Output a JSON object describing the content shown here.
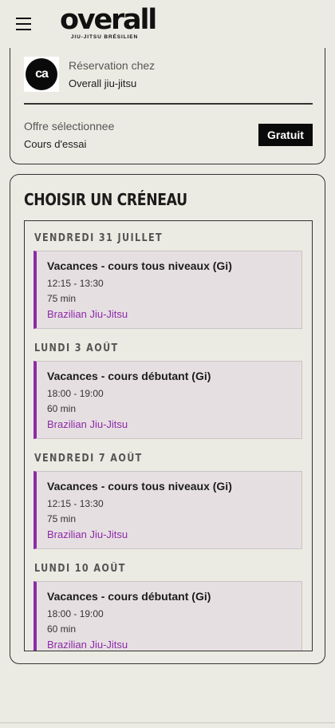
{
  "header": {
    "logo_text": "overall",
    "logo_tagline": "JIU-JITSU BRÉSILIEN"
  },
  "booking": {
    "gym_logo_text": "ca",
    "label": "Réservation chez",
    "gym_name": "Overall jiu-jitsu",
    "offer_label": "Offre sélectionnee",
    "offer_value": "Cours d'essai",
    "price_badge": "Gratuit"
  },
  "slots": {
    "title": "CHOISIR UN CRÉNEAU",
    "days": [
      {
        "date": "VENDREDI 31 JUILLET",
        "class": {
          "title": "Vacances - cours tous niveaux (Gi)",
          "time": "12:15 - 13:30",
          "duration": "75 min",
          "discipline": "Brazilian Jiu-Jitsu"
        }
      },
      {
        "date": "LUNDI 3 AOÛT",
        "class": {
          "title": "Vacances - cours débutant (Gi)",
          "time": "18:00 - 19:00",
          "duration": "60 min",
          "discipline": "Brazilian Jiu-Jitsu"
        }
      },
      {
        "date": "VENDREDI 7 AOÛT",
        "class": {
          "title": "Vacances - cours tous niveaux (Gi)",
          "time": "12:15 - 13:30",
          "duration": "75 min",
          "discipline": "Brazilian Jiu-Jitsu"
        }
      },
      {
        "date": "LUNDI 10 AOÛT",
        "class": {
          "title": "Vacances - cours débutant (Gi)",
          "time": "18:00 - 19:00",
          "duration": "60 min",
          "discipline": "Brazilian Jiu-Jitsu"
        }
      }
    ]
  },
  "colors": {
    "background": "#ecebe3",
    "accent": "#8d2aa8",
    "slot_background": "#e6dfe2"
  }
}
